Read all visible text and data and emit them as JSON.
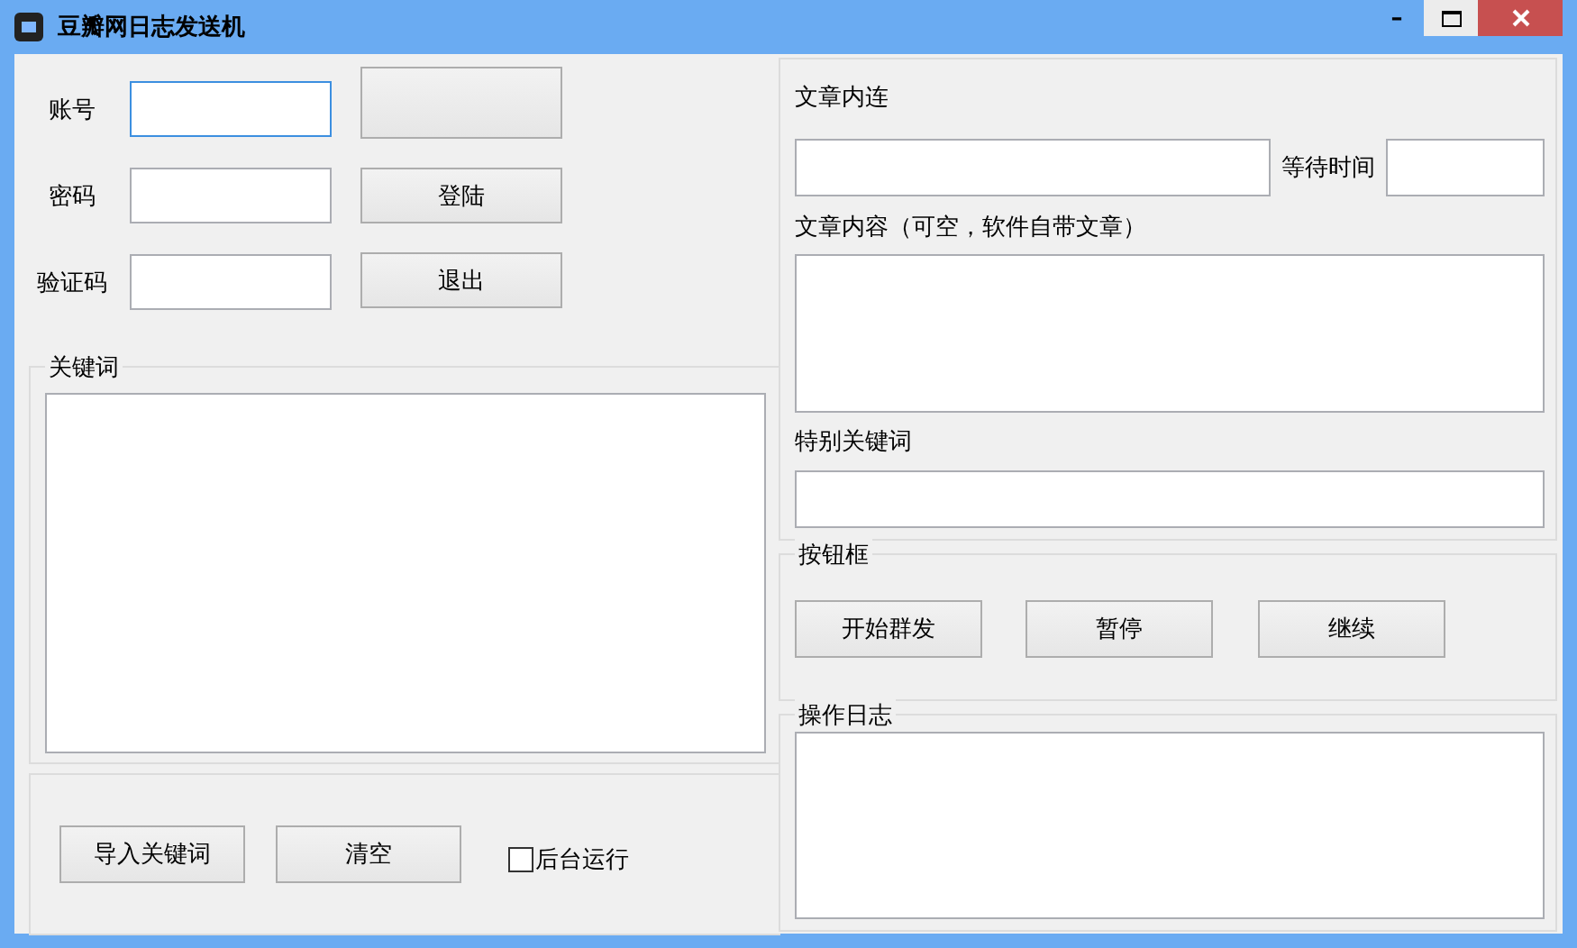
{
  "window": {
    "title": "豆瓣网日志发送机",
    "controls": [
      {
        "kind": "minimize",
        "symbol": "–"
      },
      {
        "kind": "maximize"
      },
      {
        "kind": "close"
      }
    ]
  },
  "login": {
    "fields": [
      {
        "label": "账号",
        "focused": true
      },
      {
        "label": "密码",
        "focused": false
      },
      {
        "label": "验证码",
        "focused": false
      }
    ],
    "buttons": [
      {
        "kind": "blank"
      },
      {
        "kind": "text",
        "label": "登陆"
      },
      {
        "kind": "text",
        "label": "退出"
      }
    ]
  },
  "keywords": {
    "title": "关键词"
  },
  "bottom": {
    "buttons": [
      "导入关键词",
      "清空"
    ],
    "checkbox": {
      "label": "后台运行",
      "checked": false
    }
  },
  "article": {
    "link_label": "文章内连",
    "wait_label": "等待时间",
    "content_label": "文章内容（可空，软件自带文章）",
    "special_label": "特别关键词"
  },
  "button_box": {
    "title": "按钮框",
    "buttons": [
      "开始群发",
      "暂停",
      "继续"
    ]
  },
  "log": {
    "title": "操作日志"
  }
}
